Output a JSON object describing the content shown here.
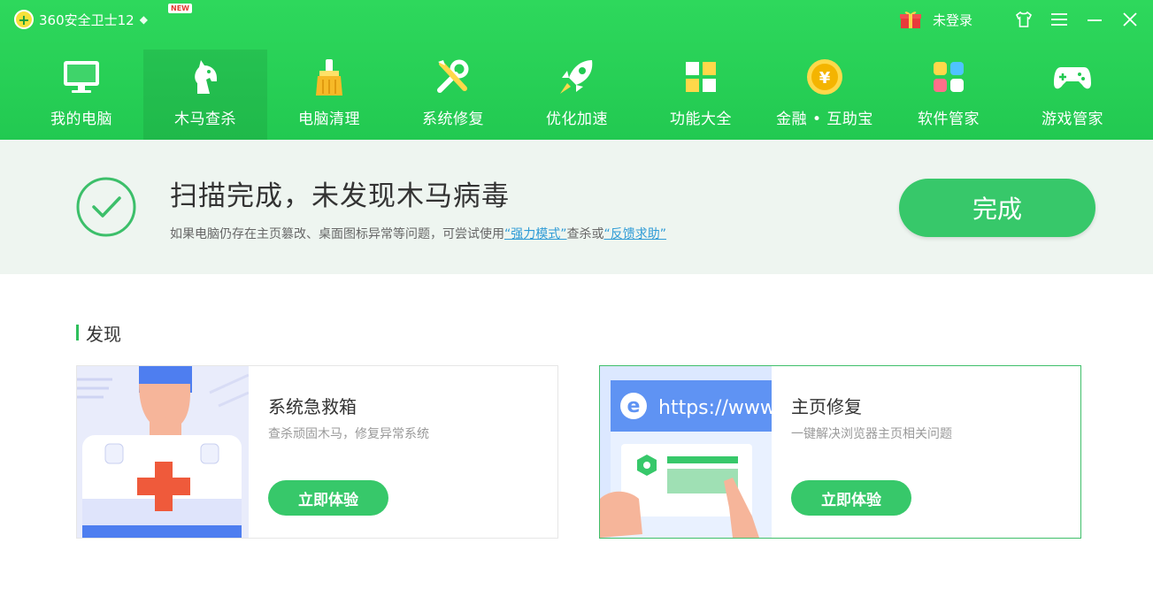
{
  "app": {
    "title": "360安全卫士12",
    "new_badge": "NEW",
    "user_status": "未登录"
  },
  "nav": [
    {
      "label": "我的电脑",
      "icon": "computer-icon"
    },
    {
      "label": "木马查杀",
      "icon": "horse-icon",
      "active": true
    },
    {
      "label": "电脑清理",
      "icon": "broom-icon"
    },
    {
      "label": "系统修复",
      "icon": "tools-icon"
    },
    {
      "label": "优化加速",
      "icon": "rocket-icon"
    },
    {
      "label": "功能大全",
      "icon": "grid-icon"
    },
    {
      "label": "金融 • 互助宝",
      "icon": "coin-icon"
    },
    {
      "label": "软件管家",
      "icon": "apps-icon"
    },
    {
      "label": "游戏管家",
      "icon": "gamepad-icon"
    }
  ],
  "result": {
    "title": "扫描完成，未发现木马病毒",
    "sub_prefix": "如果电脑仍存在主页篡改、桌面图标异常等问题，可尝试使用",
    "link1": "“强力模式”",
    "sub_mid": "查杀或",
    "link2": "“反馈求助”",
    "done_label": "完成"
  },
  "discover": {
    "title": "发现",
    "cards": [
      {
        "title": "系统急救箱",
        "desc": "查杀顽固木马，修复异常系统",
        "button": "立即体验"
      },
      {
        "title": "主页修复",
        "desc": "一键解决浏览器主页相关问题",
        "button": "立即体验",
        "image_text": "https://www"
      }
    ]
  },
  "colors": {
    "header_green": "#22c951",
    "accent_green": "#37c86a",
    "link_blue": "#2e9bd6"
  }
}
